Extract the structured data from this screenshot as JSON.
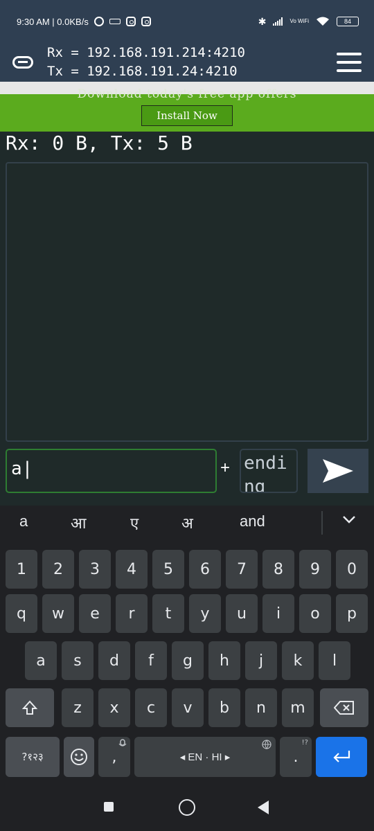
{
  "status_bar": {
    "time_speed": "9:30 AM | 0.0KB/s",
    "network_label": "Vo WiFi",
    "battery": "84"
  },
  "header": {
    "rx_address": "Rx = 192.168.191.214:4210",
    "tx_address": "Tx = 192.168.191.24:4210"
  },
  "ad": {
    "offer_text": "Download today's free app offers",
    "install_label": "Install Now"
  },
  "main": {
    "counter": "Rx: 0 B, Tx: 5 B",
    "message_value": "a|",
    "plus_label": "+",
    "ending_text": "endi ng"
  },
  "keyboard": {
    "suggestions": [
      "a",
      "आ",
      "ए",
      "अ",
      "and"
    ],
    "number_row": [
      "1",
      "2",
      "3",
      "4",
      "5",
      "6",
      "7",
      "8",
      "9",
      "0"
    ],
    "row1": [
      "q",
      "w",
      "e",
      "r",
      "t",
      "y",
      "u",
      "i",
      "o",
      "p"
    ],
    "row2": [
      "a",
      "s",
      "d",
      "f",
      "g",
      "h",
      "j",
      "k",
      "l"
    ],
    "row3": [
      "z",
      "x",
      "c",
      "v",
      "b",
      "n",
      "m"
    ],
    "symbols_label": "?१२३",
    "comma_label": ",",
    "space_label": "◂ EN · HI ▸",
    "period_label": ".",
    "period_hint": "!?"
  },
  "colors": {
    "header_bg": "#2f3f52",
    "ad_green": "#5bab1e",
    "input_border": "#2e7d32",
    "enter_blue": "#1a73e8"
  }
}
